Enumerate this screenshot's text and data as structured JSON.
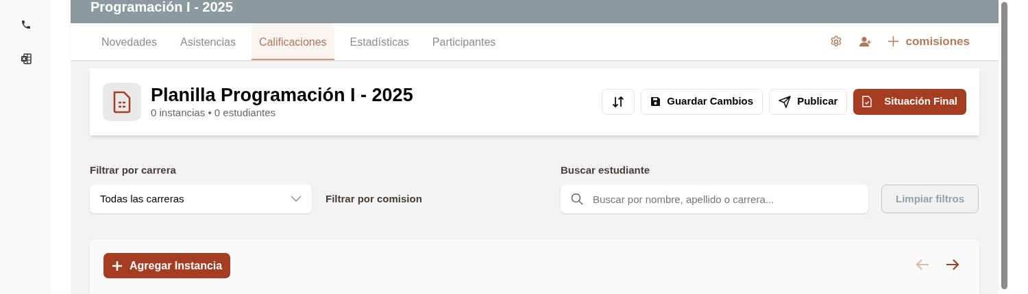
{
  "header": {
    "title": "Programación I - 2025"
  },
  "tabs": [
    {
      "label": "Novedades",
      "selected": false
    },
    {
      "label": "Asistencias",
      "selected": false
    },
    {
      "label": "Calificaciones",
      "selected": true
    },
    {
      "label": "Estadísticas",
      "selected": false
    },
    {
      "label": "Participantes",
      "selected": false
    }
  ],
  "tab_actions": {
    "add_label": "comisiones"
  },
  "sheet": {
    "title": "Planilla Programación I - 2025",
    "subtitle": "0 instancias • 0 estudiantes",
    "buttons": [
      {
        "kind": "sort"
      },
      {
        "kind": "save",
        "label": "Guardar Cambios"
      },
      {
        "kind": "publish",
        "label": "Publicar"
      },
      {
        "kind": "final",
        "label": "Situación Final"
      }
    ]
  },
  "filters": {
    "career_label": "Filtrar por carrera",
    "career_value": "Todas las carreras",
    "commission_label": "Filtrar por comision",
    "search_label": "Buscar estudiante",
    "search_placeholder": "Buscar por nombre, apellido o carrera...",
    "clear_button": "Limpiar filtros",
    "clear_disabled": true
  },
  "instances": {
    "add_button": "Agregar Instancia",
    "prev_disabled": true,
    "next_disabled": false
  }
}
